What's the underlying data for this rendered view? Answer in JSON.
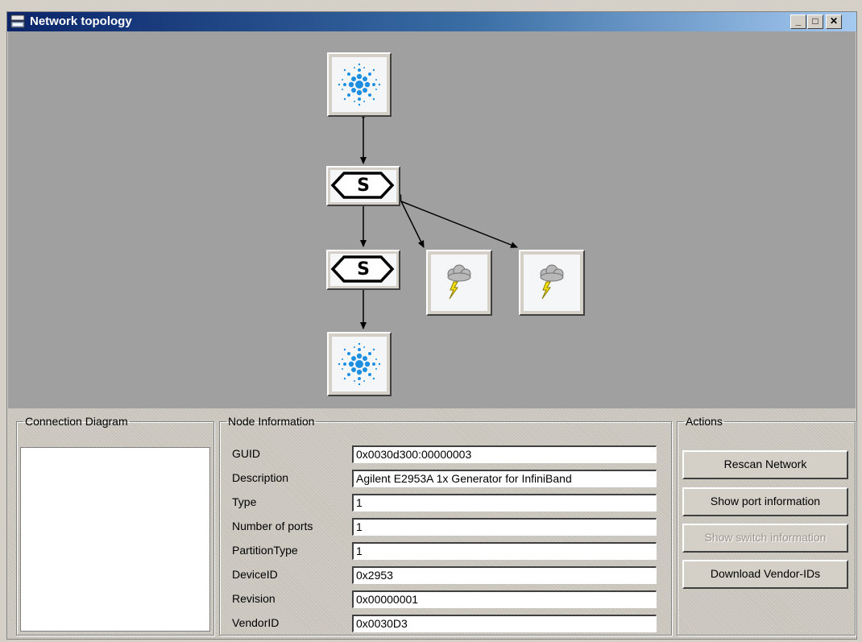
{
  "window": {
    "title": "Network topology",
    "minimize_glyph": "_",
    "maximize_glyph": "□",
    "close_glyph": "✕"
  },
  "topology": {
    "nodes": [
      {
        "kind": "host",
        "icon": "agilent-spark-icon"
      },
      {
        "kind": "switch",
        "label": "S",
        "icon": "switch-hexagon-icon"
      },
      {
        "kind": "switch",
        "label": "S",
        "icon": "switch-hexagon-icon"
      },
      {
        "kind": "generic",
        "icon": "storm-cloud-icon"
      },
      {
        "kind": "generic",
        "icon": "storm-cloud-icon"
      },
      {
        "kind": "host",
        "icon": "agilent-spark-icon"
      }
    ]
  },
  "connection_diagram": {
    "legend": "Connection Diagram"
  },
  "node_info": {
    "legend": "Node Information",
    "fields": [
      {
        "label": "GUID",
        "value": "0x0030d300:00000003"
      },
      {
        "label": "Description",
        "value": "Agilent E2953A 1x Generator for InfiniBand"
      },
      {
        "label": "Type",
        "value": "1"
      },
      {
        "label": "Number of ports",
        "value": "1"
      },
      {
        "label": "PartitionType",
        "value": "1"
      },
      {
        "label": "DeviceID",
        "value": "0x2953"
      },
      {
        "label": "Revision",
        "value": "0x00000001"
      },
      {
        "label": "VendorID",
        "value": "0x0030D3"
      }
    ]
  },
  "actions": {
    "legend": "Actions",
    "rescan": "Rescan Network",
    "show_port": "Show port information",
    "show_switch": "Show switch information",
    "download_vendor": "Download Vendor-IDs"
  },
  "colors": {
    "canvas": "#a0a0a0",
    "title_start": "#0a246a",
    "spark_blue": "#1e8fe0",
    "bolt": "#f5e010"
  }
}
